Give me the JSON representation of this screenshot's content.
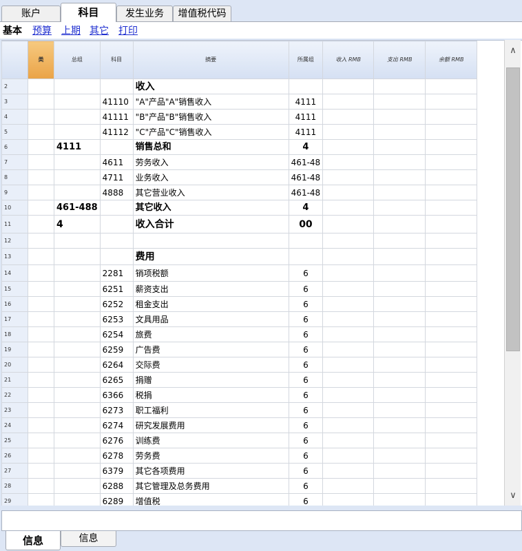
{
  "top_tabs": [
    "账户",
    "科目",
    "发生业务",
    "增值税代码"
  ],
  "views": {
    "active": "基本",
    "links": [
      "预算",
      "上期",
      "其它",
      "打印"
    ]
  },
  "columns": {
    "group": "类",
    "sum_in": "总组",
    "account": "科目",
    "description": "摘要",
    "belongs_to": "所属组",
    "income": "收入 RMB",
    "expense": "支出 RMB",
    "balance": "余额 RMB"
  },
  "rows": [
    {
      "n": "2",
      "gr": "",
      "sum": "",
      "acct": "",
      "desc": "收入",
      "to": "",
      "style": "header"
    },
    {
      "n": "3",
      "gr": "",
      "sum": "",
      "acct": "41110",
      "desc": "\"A\"产品\"A\"销售收入",
      "to": "4111",
      "style": ""
    },
    {
      "n": "4",
      "gr": "",
      "sum": "",
      "acct": "41111",
      "desc": "\"B\"产品\"B\"销售收入",
      "to": "4111",
      "style": ""
    },
    {
      "n": "5",
      "gr": "",
      "sum": "",
      "acct": "41112",
      "desc": "\"C\"产品\"C\"销售收入",
      "to": "4111",
      "style": ""
    },
    {
      "n": "6",
      "gr": "",
      "sum": "4111",
      "acct": "",
      "desc": "销售总和",
      "to": "4",
      "style": "bold"
    },
    {
      "n": "7",
      "gr": "",
      "sum": "",
      "acct": "4611",
      "desc": "劳务收入",
      "to": "461-48",
      "style": ""
    },
    {
      "n": "8",
      "gr": "",
      "sum": "",
      "acct": "4711",
      "desc": "业务收入",
      "to": "461-48",
      "style": ""
    },
    {
      "n": "9",
      "gr": "",
      "sum": "",
      "acct": "4888",
      "desc": "其它营业收入",
      "to": "461-48",
      "style": ""
    },
    {
      "n": "10",
      "gr": "",
      "sum": "461-488",
      "acct": "",
      "desc": "其它收入",
      "to": "4",
      "style": "bold"
    },
    {
      "n": "11",
      "gr": "",
      "sum": "4",
      "acct": "",
      "desc": "收入合计",
      "to": "00",
      "style": "total"
    },
    {
      "n": "12",
      "gr": "",
      "sum": "",
      "acct": "",
      "desc": "",
      "to": "",
      "style": ""
    },
    {
      "n": "13",
      "gr": "",
      "sum": "",
      "acct": "",
      "desc": "费用",
      "to": "",
      "style": "header"
    },
    {
      "n": "14",
      "gr": "",
      "sum": "",
      "acct": "2281",
      "desc": "销项税额",
      "to": "6",
      "style": ""
    },
    {
      "n": "15",
      "gr": "",
      "sum": "",
      "acct": "6251",
      "desc": "薪资支出",
      "to": "6",
      "style": ""
    },
    {
      "n": "16",
      "gr": "",
      "sum": "",
      "acct": "6252",
      "desc": "租金支出",
      "to": "6",
      "style": ""
    },
    {
      "n": "17",
      "gr": "",
      "sum": "",
      "acct": "6253",
      "desc": "文具用品",
      "to": "6",
      "style": ""
    },
    {
      "n": "18",
      "gr": "",
      "sum": "",
      "acct": "6254",
      "desc": "旅费",
      "to": "6",
      "style": ""
    },
    {
      "n": "19",
      "gr": "",
      "sum": "",
      "acct": "6259",
      "desc": "广告费",
      "to": "6",
      "style": ""
    },
    {
      "n": "20",
      "gr": "",
      "sum": "",
      "acct": "6264",
      "desc": "交际费",
      "to": "6",
      "style": ""
    },
    {
      "n": "21",
      "gr": "",
      "sum": "",
      "acct": "6265",
      "desc": "捐赠",
      "to": "6",
      "style": ""
    },
    {
      "n": "22",
      "gr": "",
      "sum": "",
      "acct": "6366",
      "desc": "税捐",
      "to": "6",
      "style": ""
    },
    {
      "n": "23",
      "gr": "",
      "sum": "",
      "acct": "6273",
      "desc": "职工福利",
      "to": "6",
      "style": ""
    },
    {
      "n": "24",
      "gr": "",
      "sum": "",
      "acct": "6274",
      "desc": "研究发展费用",
      "to": "6",
      "style": ""
    },
    {
      "n": "25",
      "gr": "",
      "sum": "",
      "acct": "6276",
      "desc": "训练费",
      "to": "6",
      "style": ""
    },
    {
      "n": "26",
      "gr": "",
      "sum": "",
      "acct": "6278",
      "desc": "劳务费",
      "to": "6",
      "style": ""
    },
    {
      "n": "27",
      "gr": "",
      "sum": "",
      "acct": "6379",
      "desc": "其它各项费用",
      "to": "6",
      "style": ""
    },
    {
      "n": "28",
      "gr": "",
      "sum": "",
      "acct": "6288",
      "desc": "其它管理及总务费用",
      "to": "6",
      "style": ""
    },
    {
      "n": "29",
      "gr": "",
      "sum": "",
      "acct": "6289",
      "desc": "增值税",
      "to": "6",
      "style": ""
    }
  ],
  "bottom_tabs": [
    "信息",
    "信息"
  ],
  "icons": {
    "scroll_up": "chevron-up-icon",
    "scroll_down": "chevron-down-icon"
  }
}
